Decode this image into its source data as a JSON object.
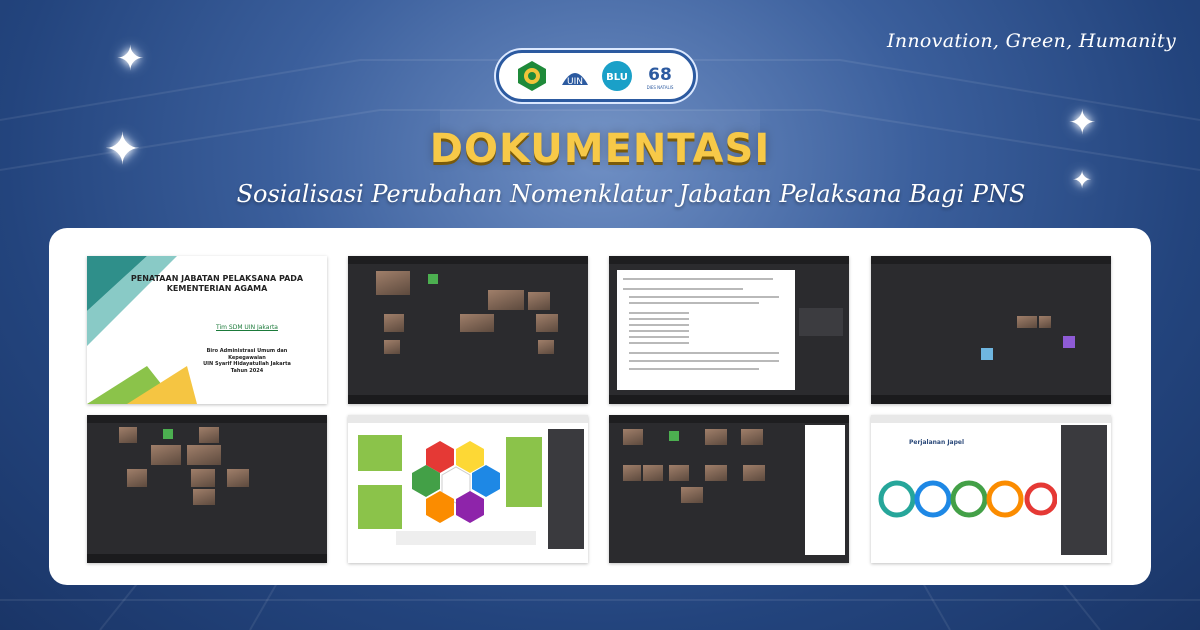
{
  "header": {
    "tagline": "Innovation, Green, Humanity",
    "title": "DOKUMENTASI",
    "subtitle": "Sosialisasi Perubahan Nomenklatur Jabatan Pelaksana Bagi PNS"
  },
  "logos": [
    {
      "name": "kemenag-logo"
    },
    {
      "name": "uin-logo",
      "text": "UIN"
    },
    {
      "name": "blu-logo",
      "text": "BLU"
    },
    {
      "name": "dies-natalis-logo",
      "text": "68",
      "caption": "DIES NATALIS"
    }
  ],
  "slide1": {
    "title_line1": "PENATAAN JABATAN PELAKSANA PADA",
    "title_line2": "KEMENTERIAN AGAMA",
    "team": "Tim SDM UIN Jakarta",
    "org_line1": "Biro Administrasi Umum dan Kepegawaian",
    "org_line2": "UIN Syarif Hidayatullah Jakarta",
    "org_line3": "Tahun 2024"
  },
  "slide8": {
    "heading": "Perjalanan Japel"
  },
  "colors": {
    "title_gold": "#f7c948",
    "bg_blue": "#2c5aa0",
    "panel": "#ffffff"
  }
}
